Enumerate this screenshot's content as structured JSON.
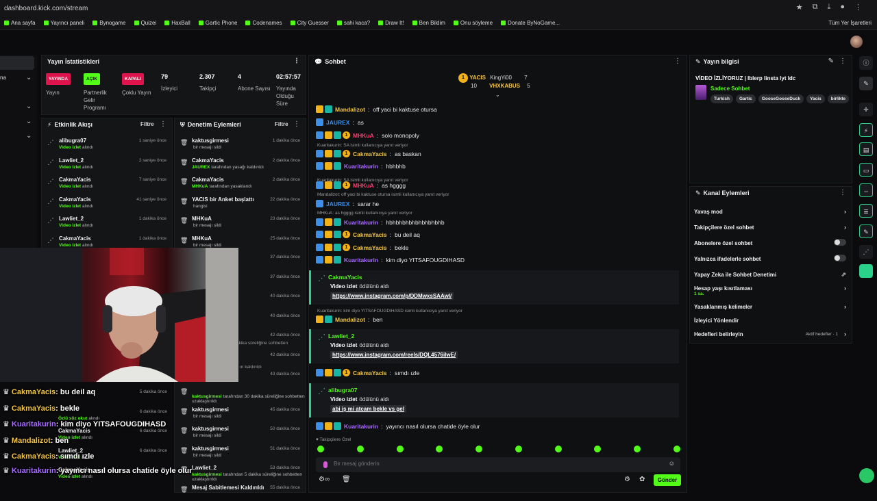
{
  "browser": {
    "url": "dashboard.kick.com/stream",
    "bookmarks": [
      "Ana sayfa",
      "Yayıncı paneli",
      "Bynogame",
      "Quizei",
      "HaxBall",
      "Gartic Phone",
      "Codenames",
      "City Guesser",
      "sahi kaca?",
      "Draw It!",
      "Ben Bildim",
      "Onu söyleme",
      "Donate ByNoGame..."
    ],
    "all_bookmarks": "Tüm Yer İşaretleri"
  },
  "left": {
    "label": "na"
  },
  "stats": {
    "title": "Yayın İstatistikleri",
    "items": [
      {
        "pill": "YAYINDA",
        "label": "Yayın"
      },
      {
        "pill": "AÇIK",
        "label": "Partnerlik Gelir Programı"
      },
      {
        "pill": "KAPALI",
        "label": "Çoklu Yayın"
      },
      {
        "value": "79",
        "label": "İzleyici"
      },
      {
        "value": "2.307",
        "label": "Takipçi"
      },
      {
        "value": "4",
        "label": "Abone Sayısı"
      },
      {
        "value": "02:57:57",
        "label": "Yayında Olduğu Süre"
      }
    ]
  },
  "activity": {
    "title": "Etkinlik Akışı",
    "filter": "Filtre",
    "rows": [
      {
        "name": "alibugra07",
        "sub_b": "Video izlet",
        "sub": "alındı",
        "time": "1 saniye önce"
      },
      {
        "name": "Lawliet_2",
        "sub_b": "Video izlet",
        "sub": "alındı",
        "time": "2 saniye önce"
      },
      {
        "name": "CakmaYacis",
        "sub_b": "Video izlet",
        "sub": "alındı",
        "time": "7 saniye önce"
      },
      {
        "name": "CakmaYacis",
        "sub_b": "Video izlet",
        "sub": "alındı",
        "time": "41 saniye önce"
      },
      {
        "name": "Lawliet_2",
        "sub_b": "Video izlet",
        "sub": "alındı",
        "time": "1 dakika önce"
      },
      {
        "name": "CakmaYacis",
        "sub_b": "Video izlet",
        "sub": "alındı",
        "time": "1 dakika önce"
      }
    ]
  },
  "modlog": {
    "title": "Denetim Eylemleri",
    "filter": "Filtre",
    "rows": [
      {
        "name": "kaktusgirmesi",
        "sub_b": "",
        "sub": "bir mesajı sildi",
        "time": "1 dakika önce"
      },
      {
        "name": "CakmaYacis",
        "sub_b": "JAUREX",
        "sub": "tarafından yasağı kaldırıldı",
        "time": "2 dakika önce"
      },
      {
        "name": "CakmaYacis",
        "sub_b": "MHKuA",
        "sub": "tarafından yasaklandı",
        "time": "2 dakika önce"
      },
      {
        "name": "YACIS bir Anket başlattı",
        "sub_b": "",
        "sub": "hangisi",
        "time": "22 dakika önce"
      },
      {
        "name": "MHKuA",
        "sub_b": "",
        "sub": "bir mesajı sildi",
        "time": "23 dakika önce"
      },
      {
        "name": "MHKuA",
        "sub_b": "",
        "sub": "bir mesajı sildi",
        "time": "25 dakika önce"
      }
    ],
    "hidden_times": [
      "37 dakika önce",
      "37 dakika önce",
      "40 dakika önce",
      "40 dakika önce",
      "42 dakika önce",
      "42 dakika önce",
      "43 dakika önce"
    ],
    "partial": [
      "akika süreliğine sohbetten",
      "ın kaldırıldı"
    ],
    "lower_rows": [
      {
        "name": "",
        "sub_b": "kaktusgirmesi",
        "sub": "tarafından 30 dakika süreliğine sohbetten uzaklaştırıldı",
        "time": ""
      },
      {
        "name": "kaktusgirmesi",
        "sub_b": "",
        "sub": "bir mesajı sildi",
        "time": "45 dakika önce"
      },
      {
        "name": "kaktusgirmesi",
        "sub_b": "",
        "sub": "bir mesajı sildi",
        "time": "50 dakika önce"
      },
      {
        "name": "kaktusgirmesi",
        "sub_b": "",
        "sub": "bir mesajı sildi",
        "time": "51 dakika önce"
      },
      {
        "name": "Lawliet_2",
        "sub_b": "kaktusgirmesi",
        "sub": "tarafından 5 dakika süreliğine sohbetten uzaklaştırıldı",
        "time": "53 dakika önce"
      },
      {
        "name": "Mesaj Sabitlemesi Kaldırıldı",
        "sub_b": "",
        "sub": "",
        "time": "55 dakika önce"
      }
    ]
  },
  "overlay": [
    {
      "user": "CakmaYacis",
      "text": "bu deil aq"
    },
    {
      "user": "CakmaYacis",
      "text": "bekle"
    },
    {
      "user": "Kuaritakurin",
      "text": "kim diyo YITSAFOUGDIHASD"
    },
    {
      "user": "Mandalizot",
      "text": "ben"
    },
    {
      "user": "CakmaYacis",
      "text": "sımdı ızle"
    },
    {
      "user": "Kuaritakurin",
      "text": "yayıncı nasıl olursa chatide öyle olur"
    }
  ],
  "overlay_bg": {
    "rows": [
      {
        "time": "5 dakika önce",
        "name": "",
        "sub_b": "",
        "sub": ""
      },
      {
        "time": "6 dakika önce",
        "name": "",
        "sub_b": "Özlü söz okut",
        "sub": "alındı"
      },
      {
        "time": "6 dakika önce",
        "name": "CakmaYacis",
        "sub_b": "Video izlet",
        "sub": "alındı"
      },
      {
        "time": "6 dakika önce",
        "name": "Lawliet_2",
        "sub_b": "Video izlet",
        "sub": "alındı"
      },
      {
        "time": "",
        "name": "CakmaYacis",
        "sub_b": "Video izlet",
        "sub": "alındı"
      }
    ]
  },
  "chat": {
    "title": "Sohbet",
    "leaderboard": {
      "u1": "YACIS",
      "v1": "10",
      "u2": "KingYi00",
      "v2": "7",
      "u3": "VHXKABUS",
      "v3": "5"
    },
    "reply_prefix": "isimli kullanıcıya yanıt veriyor",
    "messages": [
      {
        "user": "Mandalizot",
        "text": "off yaci bi kaktuse otursa"
      },
      {
        "user": "JAUREX",
        "text": "as"
      },
      {
        "user": "MHKuA",
        "text": "solo monopoly"
      },
      {
        "reply": "Kuaritakurin: SA isimli kullanıcıya yanıt veriyor"
      },
      {
        "user": "CakmaYacis",
        "text": "as baskan"
      },
      {
        "user": "Kuaritakurin",
        "text": "hbhbhb"
      },
      {
        "reply": "Kuaritakurin: SA isimli kullanıcıya yanıt veriyor"
      },
      {
        "user": "MHKuA",
        "text": "as hgggg"
      },
      {
        "reply": "Mandalizot: off yaci bi kaktuse otursa isimli kullanıcıya yanıt veriyor"
      },
      {
        "user": "JAUREX",
        "text": "sarar he"
      },
      {
        "reply": "MHKuA: as hgggg isimli kullanıcıya yanıt veriyor"
      },
      {
        "user": "Kuaritakurin",
        "text": "hbhbhbhbhbhbhbhbhb"
      },
      {
        "user": "CakmaYacis",
        "text": "bu deil aq"
      },
      {
        "user": "CakmaYacis",
        "text": "bekle"
      },
      {
        "user": "Kuaritakurin",
        "text": "kim diyo YITSAFOUGDIHASD"
      }
    ],
    "rewards": [
      {
        "user": "CakmaYacis",
        "reward": "Video izlet",
        "suffix": "ödülünü aldı",
        "link": "https://www.instagram.com/p/DDMwxsSAAwI/"
      },
      {
        "user": "Lawliet_2",
        "reward": "Video izlet",
        "suffix": "ödülünü aldı",
        "link": "https://www.instagram.com/reels/DQL4576ilwE/"
      },
      {
        "user": "alibugra07",
        "reward": "Video izlet",
        "suffix": "ödülünü aldı",
        "link": "abi iş mi atcam bekle vs gel"
      }
    ],
    "reply2": "Kuaritakurin: kim diyo YITSAFOUGDIHASD isimli kullanıcıya yanıt veriyor",
    "msg_ben": {
      "user": "Mandalizot",
      "text": "ben"
    },
    "msg_simdi": {
      "user": "CakmaYacis",
      "text": "sımdı ızle"
    },
    "msg_last": {
      "user": "Kuaritakurin",
      "text": "yayıncı nasıl olursa chatide öyle olur"
    },
    "mode": "Takipçilere Özel",
    "input_placeholder": "Bir mesaj gönderin",
    "send": "Gönder"
  },
  "info": {
    "title": "Yayın bilgisi",
    "stream_title": "VİDEO İZLİYORUZ | lblerp linsta lyt ldc",
    "category": "Sadece Sohbet",
    "tags": [
      "Turkish",
      "Gartic",
      "GooseGooseDuck",
      "Yacis",
      "birlikte"
    ]
  },
  "actions": {
    "title": "Kanal Eylemleri",
    "items": [
      {
        "label": "Yavaş mod"
      },
      {
        "label": "Takipçilere özel sohbet"
      },
      {
        "label": "Abonelere özel sohbet"
      },
      {
        "label": "Yalnızca ifadelerle sohbet"
      },
      {
        "label": "Yapay Zeka ile Sohbet Denetimi"
      },
      {
        "label": "Hesap yaşı kısıtlaması",
        "sub": "1 sa."
      },
      {
        "label": "Yasaklanmış kelimeler"
      },
      {
        "label": "İzleyici Yönlendir"
      },
      {
        "label": "Hedefleri belirleyin",
        "badge": "Aktif hedefler · 1"
      }
    ]
  },
  "colors": {
    "accent": "#53fc18",
    "live": "#e0144c",
    "panel": "#141517"
  }
}
